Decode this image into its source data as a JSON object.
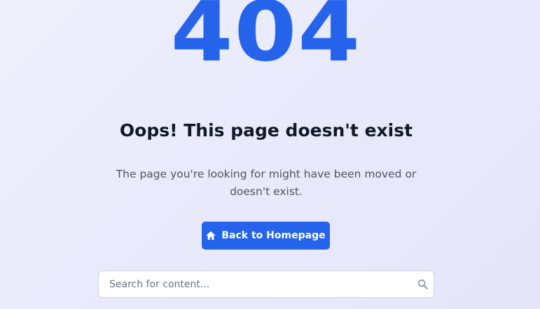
{
  "error": {
    "code": "404",
    "title": "Oops! This page doesn't exist",
    "message": "The page you're looking for might have been moved or doesn't exist."
  },
  "actions": {
    "home_button_label": "Back to Homepage",
    "home_button_icon": "home-icon"
  },
  "search": {
    "placeholder": "Search for content...",
    "value": "",
    "icon": "search-icon"
  },
  "colors": {
    "accent": "#2563eb",
    "title": "#111827",
    "body_text": "#4b5563",
    "background": "#e8e9fb"
  }
}
